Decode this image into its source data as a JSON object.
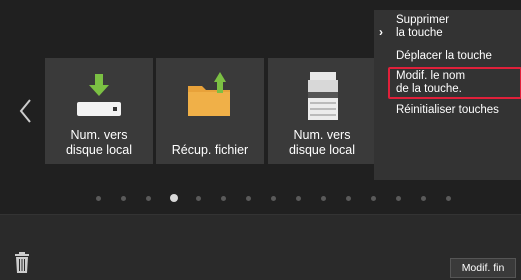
{
  "tiles": [
    {
      "label_line1": "Num. vers",
      "label_line2": "disque local",
      "icon": "hdd-download-icon"
    },
    {
      "label_line1": "Récup. fichier",
      "label_line2": "",
      "icon": "folder-upload-icon"
    },
    {
      "label_line1": "Num. vers",
      "label_line2": "disque local",
      "icon": "printer-scanner-icon"
    }
  ],
  "page_indicator": {
    "total": 15,
    "current": 4
  },
  "menu": {
    "items": [
      {
        "line1": "Supprimer",
        "line2": "la touche",
        "has_submenu": true
      },
      {
        "line1": "Déplacer la touche",
        "line2": ""
      },
      {
        "line1": "Modif. le nom",
        "line2": "de la touche.",
        "highlighted": true
      },
      {
        "line1": "Réinitialiser touches",
        "line2": ""
      }
    ]
  },
  "footer": {
    "done_label": "Modif. fin"
  },
  "colors": {
    "accent_yellow": "#e8c44a",
    "highlight_red": "#e0203a",
    "download_green": "#7bc043",
    "folder_orange": "#e8a23a"
  }
}
